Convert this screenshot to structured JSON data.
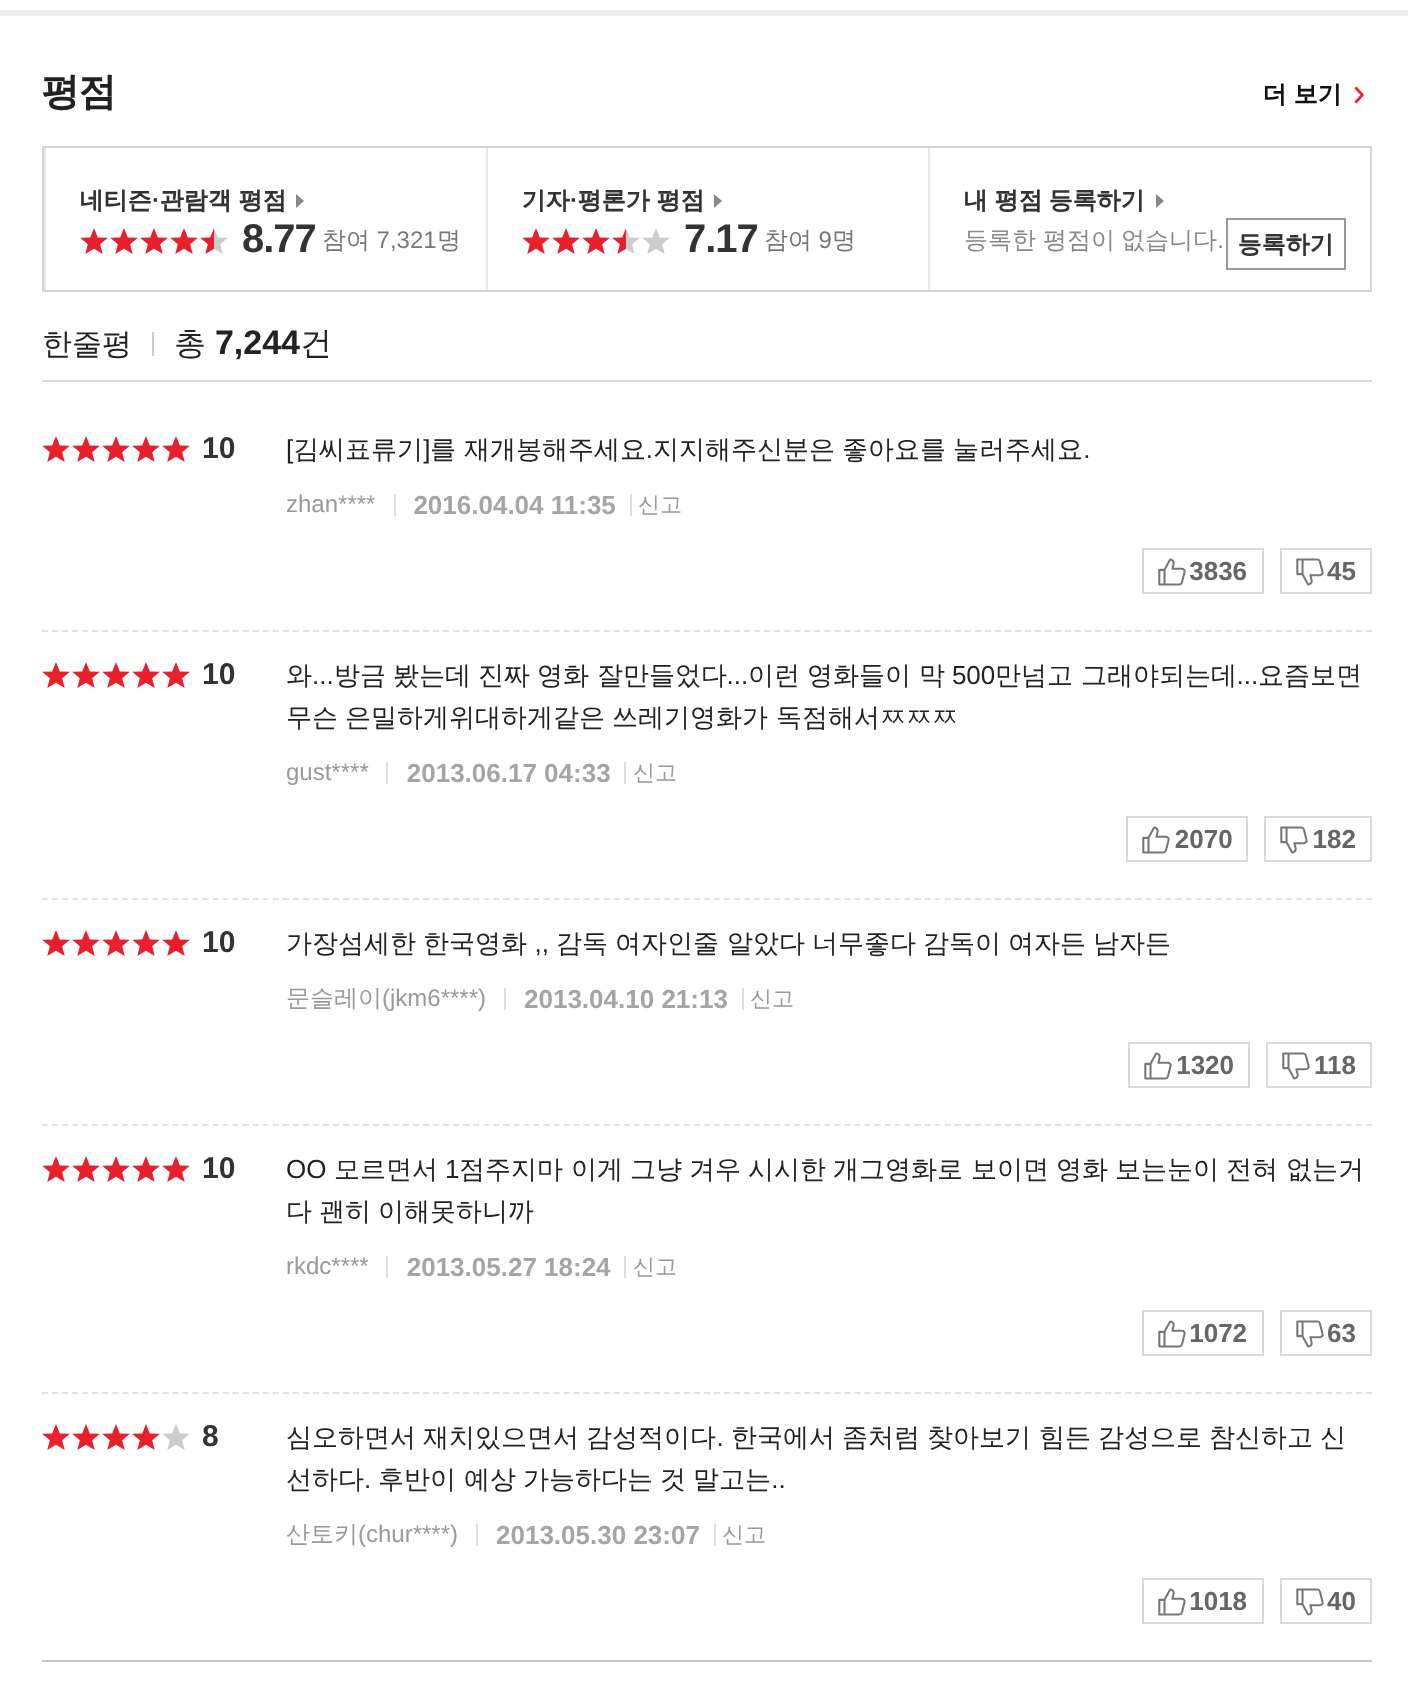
{
  "header": {
    "title": "평점",
    "more_link": "더 보기"
  },
  "summary": [
    {
      "kind": "score",
      "label": "네티즌·관람객 평점",
      "stars": 4.5,
      "score": "8.77",
      "participants": "참여 7,321명"
    },
    {
      "kind": "score",
      "label": "기자·평론가 평점",
      "stars": 3.5,
      "score": "7.17",
      "participants": "참여 9명"
    },
    {
      "kind": "register",
      "label": "내 평점 등록하기",
      "message": "등록한 평점이 없습니다.",
      "button": "등록하기"
    }
  ],
  "reviews_header": {
    "title": "한줄평",
    "total": "총 **7,244**건"
  },
  "reviews": [
    {
      "stars": 5,
      "score": "10",
      "text": "[김씨표류기]를 재개봉해주세요.지지해주신분은 좋아요를 눌러주세요.",
      "user": "zhan****",
      "date": "2016.04.04 11:35",
      "report": "신고",
      "likes": "3836",
      "dislikes": "45"
    },
    {
      "stars": 5,
      "score": "10",
      "text": "와...방금 봤는데 진짜 영화 잘만들었다...이런 영화들이 막 500만넘고 그래야되는데...요즘보면 무슨 은밀하게위대하게같은 쓰레기영화가 독점해서ㅉㅉㅉ",
      "user": "gust****",
      "date": "2013.06.17 04:33",
      "report": "신고",
      "likes": "2070",
      "dislikes": "182"
    },
    {
      "stars": 5,
      "score": "10",
      "text": "가장섬세한 한국영화 ,, 감독 여자인줄 알았다 너무좋다 감독이 여자든 남자든",
      "user": "문슬레이(jkm6****)",
      "date": "2013.04.10 21:13",
      "report": "신고",
      "likes": "1320",
      "dislikes": "118"
    },
    {
      "stars": 5,
      "score": "10",
      "text": "OO 모르면서 1점주지마 이게 그냥 겨우 시시한 개그영화로 보이면 영화 보는눈이 전혀 없는거다 괜히 이해못하니까",
      "user": "rkdc****",
      "date": "2013.05.27 18:24",
      "report": "신고",
      "likes": "1072",
      "dislikes": "63"
    },
    {
      "stars": 4,
      "score": "8",
      "text": "심오하면서 재치있으면서 감성적이다. 한국에서 좀처럼 찾아보기 힘든 감성으로 참신하고 신선하다. 후반이 예상 가능하다는 것 말고는..",
      "user": "산토키(chur****)",
      "date": "2013.05.30 23:07",
      "report": "신고",
      "likes": "1018",
      "dislikes": "40"
    }
  ]
}
